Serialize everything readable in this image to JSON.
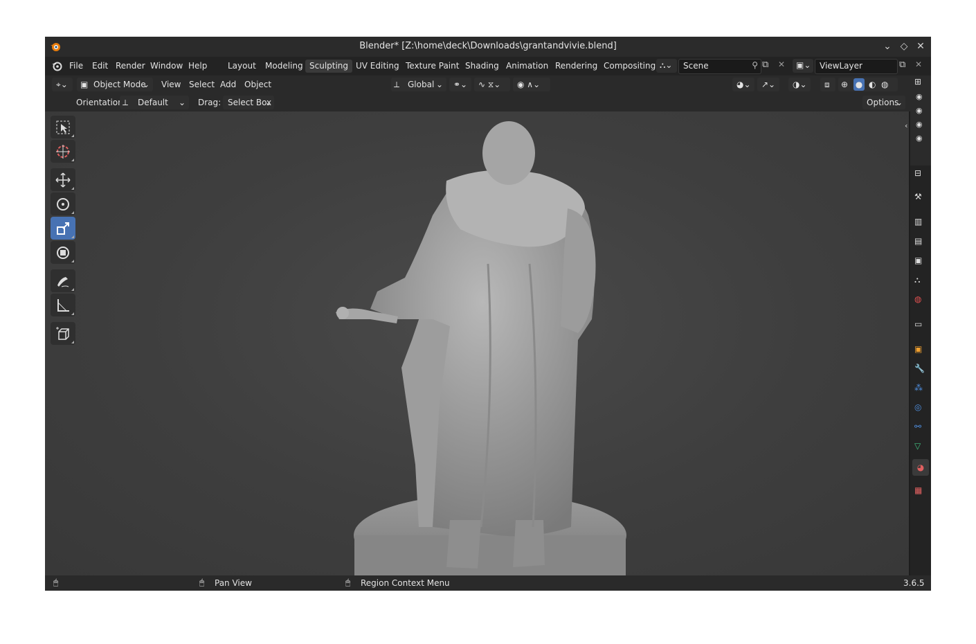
{
  "window": {
    "title": "Blender* [Z:\\home\\deck\\Downloads\\grantandvivie.blend]"
  },
  "menu": [
    "File",
    "Edit",
    "Render",
    "Window",
    "Help"
  ],
  "workspaces": {
    "tabs": [
      "Layout",
      "Modeling",
      "Sculpting",
      "UV Editing",
      "Texture Paint",
      "Shading",
      "Animation",
      "Rendering",
      "Compositing"
    ],
    "active": "Sculpting"
  },
  "scene": {
    "name": "Scene"
  },
  "view_layer": {
    "name": "ViewLayer"
  },
  "header": {
    "mode": "Object Mode",
    "menus": [
      "View",
      "Select",
      "Add",
      "Object"
    ],
    "transform_orientation": "Global",
    "options_label": "Options"
  },
  "tool_header": {
    "orientation_label": "Orientation:",
    "orientation_value": "Default",
    "drag_label": "Drag:",
    "drag_value": "Select Box"
  },
  "status": {
    "pan": "Pan View",
    "context": "Region Context Menu",
    "version": "3.6.5"
  },
  "colors": {
    "accent": "#4772b3",
    "viewport": "#3e3e3e",
    "panel": "#2a2a2a"
  }
}
